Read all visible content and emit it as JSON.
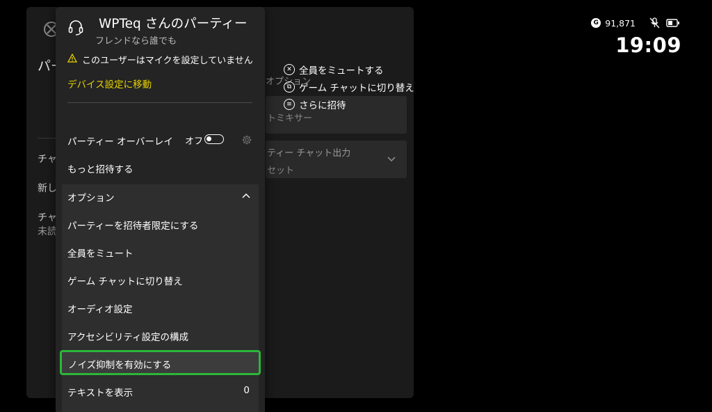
{
  "background": {
    "title_partial": "パー",
    "chat_item_1": "チャッ",
    "new_item": "新し",
    "chat_item_2": "チャッ",
    "unread_item": "未読",
    "options_title": "オプション",
    "mixer_card": "トミキサー",
    "output_card_title": "ティー チャット出力",
    "output_card_value": "セット"
  },
  "hints": [
    {
      "icon": "x-button-icon",
      "glyph": "✕",
      "label": "全員をミュートする"
    },
    {
      "icon": "view-button-icon",
      "glyph": "⧉",
      "label": "ゲーム チャットに切り替え"
    },
    {
      "icon": "menu-button-icon",
      "glyph": "≡",
      "label": "さらに招待"
    }
  ],
  "status": {
    "gamerscore_icon": "G",
    "gamerscore": "91,871",
    "clock": "19:09"
  },
  "party": {
    "title": "WPTeq さんのパーティー",
    "subtitle": "フレンドなら誰でも",
    "warning": "このユーザーはマイクを設定していません",
    "device_link": "デバイス設定に移動",
    "overlay_label": "パーティー オーバーレイ",
    "overlay_state": "オフ",
    "invite_more": "もっと招待する",
    "options_header": "オプション",
    "options": [
      {
        "label": "パーティーを招待者限定にする"
      },
      {
        "label": "全員をミュート"
      },
      {
        "label": "ゲーム チャットに切り替え"
      },
      {
        "label": "オーディオ設定"
      },
      {
        "label": "アクセシビリティ設定の構成"
      },
      {
        "label": "ノイズ抑制を有効にする"
      },
      {
        "label": "テキストを表示",
        "count": "0"
      }
    ]
  },
  "colors": {
    "focus": "#2bb73a",
    "link": "#e9d400",
    "flyout_bg": "#242424"
  }
}
